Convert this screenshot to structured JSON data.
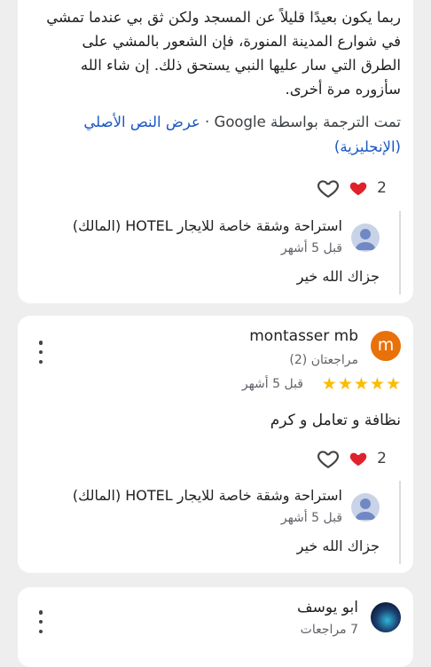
{
  "reviews": [
    {
      "text": "ربما يكون بعيدًا قليلاً عن المسجد ولكن ثق بي عندما تمشي في شوارع المدينة المنورة، فإن الشعور بالمشي على الطرق التي سار عليها النبي يستحق ذلك. إن شاء الله سأزوره مرة أخرى.",
      "translated_by": "تمت الترجمة بواسطة Google",
      "separator": "·",
      "show_original": "عرض النص الأصلي (الإنجليزية)",
      "likes": "2",
      "owner_reply": {
        "name": "استراحة وشقة خاصة للايجار HOTEL (المالك)",
        "time": "قبل 5 أشهر",
        "text": "جزاك الله خير"
      }
    },
    {
      "user": "montasser mb",
      "avatar_letter": "m",
      "avatar_color": "#e8710a",
      "meta": "مراجعتان (2)",
      "rating": 5,
      "time": "قبل 5 أشهر",
      "text": "نظافة و تعامل و كرم",
      "likes": "2",
      "owner_reply": {
        "name": "استراحة وشقة خاصة للايجار HOTEL (المالك)",
        "time": "قبل 5 أشهر",
        "text": "جزاك الله خير"
      }
    },
    {
      "user": "ابو يوسف",
      "meta": "7 مراجعات"
    }
  ],
  "icons": {
    "menu": "more-vert-icon",
    "like": "heart-outline-icon",
    "liked": "heart-filled-icon",
    "owner_avatar": "person-icon",
    "star": "star-icon"
  },
  "colors": {
    "heart": "#e0212b",
    "star": "#fbbc04",
    "link": "#1a56c4"
  }
}
